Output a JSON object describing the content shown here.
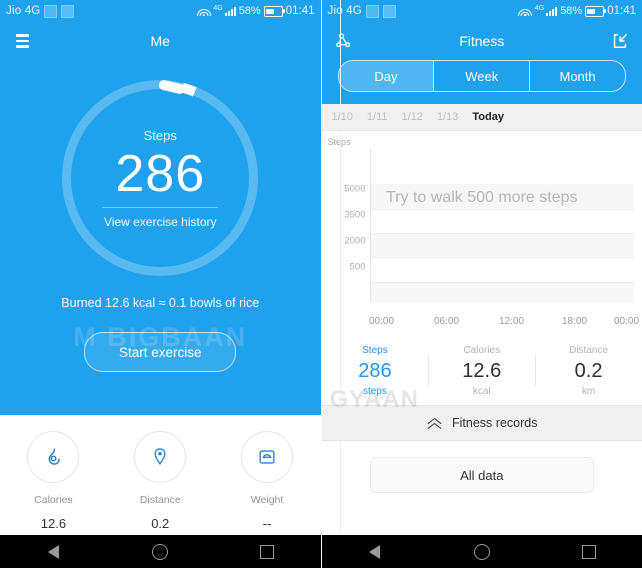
{
  "statusbar": {
    "carrier": "Jio 4G",
    "network": "4G",
    "battery_percent": "58%",
    "time": "01:41"
  },
  "left_screen": {
    "appbar": {
      "title": "Me",
      "menu_icon": "hamburger-menu-icon"
    },
    "ring": {
      "steps_label": "Steps",
      "steps_value": "286",
      "history_link": "View exercise history"
    },
    "burned_text": "Burned 12.6 kcal ≈ 0.1 bowls of rice",
    "start_button": "Start exercise",
    "tiles": [
      {
        "icon": "flame-icon",
        "label": "Calories",
        "value": "12.6"
      },
      {
        "icon": "location-pin-icon",
        "label": "Distance",
        "value": "0.2"
      },
      {
        "icon": "weight-scale-icon",
        "label": "Weight",
        "value": "--"
      }
    ]
  },
  "right_screen": {
    "appbar": {
      "title": "Fitness",
      "left_icon": "share-nodes-icon",
      "right_icon": "export-box-icon"
    },
    "segments": [
      {
        "label": "Day",
        "active": true
      },
      {
        "label": "Week",
        "active": false
      },
      {
        "label": "Month",
        "active": false
      }
    ],
    "dates": [
      {
        "label": "1/10",
        "active": false
      },
      {
        "label": "1/11",
        "active": false
      },
      {
        "label": "1/12",
        "active": false
      },
      {
        "label": "1/13",
        "active": false
      },
      {
        "label": "Today",
        "active": true
      }
    ],
    "chart_overlay_message": "Try to walk 500 more steps",
    "stats": [
      {
        "label": "Steps",
        "value": "286",
        "unit": "steps",
        "active": true
      },
      {
        "label": "Calories",
        "value": "12.6",
        "unit": "kcal",
        "active": false
      },
      {
        "label": "Distance",
        "value": "0.2",
        "unit": "km",
        "active": false
      }
    ],
    "records_label": "Fitness records",
    "records_icon": "double-chevron-up-icon",
    "all_data_button": "All data"
  },
  "chart_data": {
    "type": "line",
    "title": "",
    "xlabel": "",
    "ylabel": "Steps",
    "x_ticks": [
      "00:00",
      "06:00",
      "12:00",
      "18:00",
      "00:00"
    ],
    "y_ticks": [
      "5000",
      "3500",
      "2000",
      "500"
    ],
    "ylim": [
      0,
      6500
    ],
    "grid": true,
    "legend": "none",
    "annotation": "Try to walk 500 more steps",
    "series": [
      {
        "name": "Steps",
        "x": [
          "00:00",
          "06:00",
          "12:00",
          "18:00",
          "00:00"
        ],
        "values": [
          0,
          0,
          0,
          0,
          0
        ]
      }
    ]
  },
  "navbar": {
    "back": "back-button",
    "home": "home-button",
    "recents": "recents-button"
  },
  "colors": {
    "brand_blue": "#1fa2ee",
    "accent_blue": "#2196f3",
    "panel_gray": "#f0f0f0"
  },
  "watermark": {
    "left": "M  BIGBAAN",
    "right": "GYAAN"
  }
}
